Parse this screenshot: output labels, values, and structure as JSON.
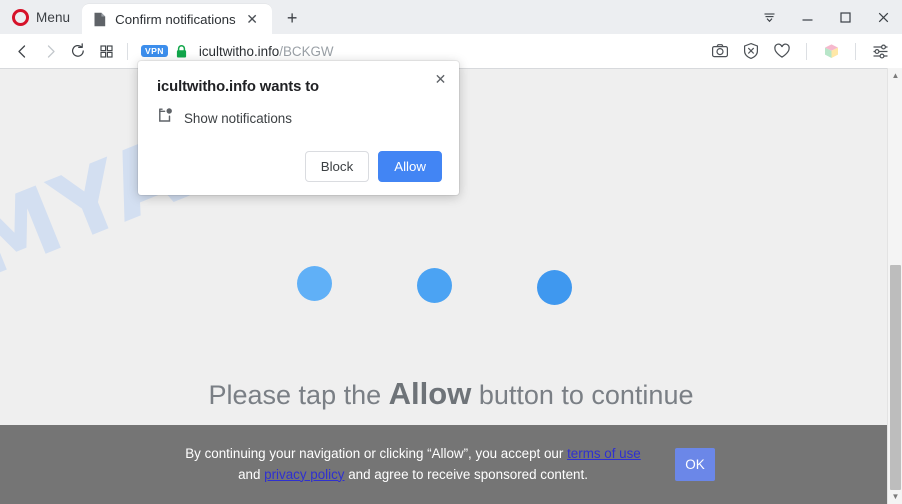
{
  "browser": {
    "menu_label": "Menu",
    "opera_logo_name": "opera-logo",
    "tab": {
      "title": "Confirm notifications",
      "close_label": "✕",
      "favicon_name": "page-favicon"
    },
    "newtab_label": "+",
    "window_controls": {
      "tab_menu_label": "☰",
      "minimize_label": "–",
      "maximize_label": "□",
      "close_label": "✕"
    },
    "nav": {
      "back_label": "‹",
      "forward_label": "›",
      "reload_label": "⟳",
      "speeddial_label": "⌸"
    },
    "address": {
      "vpn_badge": "VPN",
      "lock_name": "secure-lock-icon",
      "domain": "icultwitho.info",
      "path": "/BCKGW"
    },
    "toolbar_icons": [
      {
        "name": "snapshot-icon",
        "glyph": "camera"
      },
      {
        "name": "ad-blocker-icon",
        "glyph": "shield-x"
      },
      {
        "name": "favorites-heart-icon",
        "glyph": "heart"
      },
      {
        "name": "extensions-cube-icon",
        "glyph": "cube"
      },
      {
        "name": "easy-setup-icon",
        "glyph": "sliders"
      }
    ]
  },
  "permission_dialog": {
    "title": "icultwitho.info wants to",
    "permission_label": "Show notifications",
    "permission_icon_name": "notification-badge-icon",
    "close_label": "✕",
    "block_label": "Block",
    "allow_label": "Allow",
    "allow_color": "#4285f4"
  },
  "page": {
    "watermark": "MYANTISPYWARE.COM",
    "watermark_color": "#c9d9f2",
    "background_color": "#efefef",
    "loading_dots": [
      {
        "name": "loading-dot-1",
        "color": "#60b0f7"
      },
      {
        "name": "loading-dot-2",
        "color": "#4ba3f3"
      },
      {
        "name": "loading-dot-3",
        "color": "#3f98ef"
      }
    ],
    "instruction": {
      "before": "Please tap the ",
      "emphasis": "Allow",
      "after": " button to continue"
    },
    "consent": {
      "part1": "By continuing your navigation or clicking “Allow”, you accept our ",
      "link1": "terms of use",
      "mid": " and ",
      "link2": "privacy policy",
      "part2": " and agree to receive sponsored content.",
      "ok_label": "OK",
      "bar_color": "#757575",
      "ok_color": "#6b87e8",
      "link_color": "#2f30d0"
    }
  },
  "scrollbar": {
    "up_label": "▲",
    "down_label": "▼"
  }
}
